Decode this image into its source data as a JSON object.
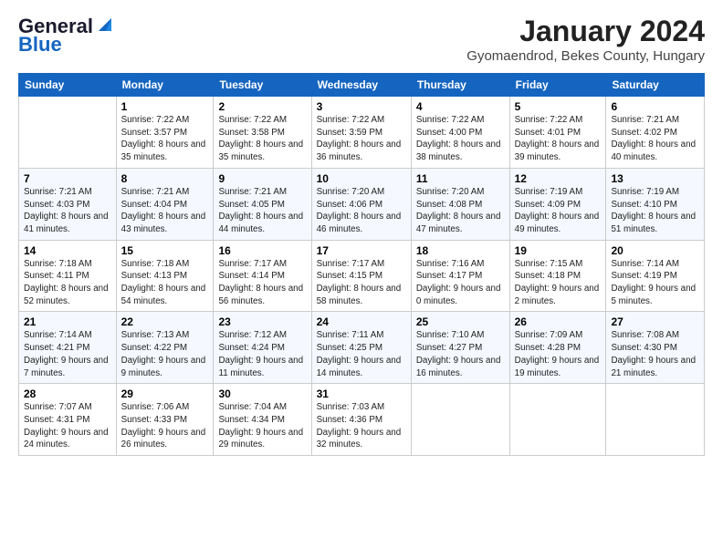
{
  "logo": {
    "line1": "General",
    "line2": "Blue"
  },
  "title": "January 2024",
  "subtitle": "Gyomaendrod, Bekes County, Hungary",
  "days_of_week": [
    "Sunday",
    "Monday",
    "Tuesday",
    "Wednesday",
    "Thursday",
    "Friday",
    "Saturday"
  ],
  "weeks": [
    [
      {
        "day": null,
        "info": null
      },
      {
        "day": "1",
        "sunrise": "7:22 AM",
        "sunset": "3:57 PM",
        "daylight": "8 hours and 35 minutes."
      },
      {
        "day": "2",
        "sunrise": "7:22 AM",
        "sunset": "3:58 PM",
        "daylight": "8 hours and 35 minutes."
      },
      {
        "day": "3",
        "sunrise": "7:22 AM",
        "sunset": "3:59 PM",
        "daylight": "8 hours and 36 minutes."
      },
      {
        "day": "4",
        "sunrise": "7:22 AM",
        "sunset": "4:00 PM",
        "daylight": "8 hours and 38 minutes."
      },
      {
        "day": "5",
        "sunrise": "7:22 AM",
        "sunset": "4:01 PM",
        "daylight": "8 hours and 39 minutes."
      },
      {
        "day": "6",
        "sunrise": "7:21 AM",
        "sunset": "4:02 PM",
        "daylight": "8 hours and 40 minutes."
      }
    ],
    [
      {
        "day": "7",
        "sunrise": "7:21 AM",
        "sunset": "4:03 PM",
        "daylight": "8 hours and 41 minutes."
      },
      {
        "day": "8",
        "sunrise": "7:21 AM",
        "sunset": "4:04 PM",
        "daylight": "8 hours and 43 minutes."
      },
      {
        "day": "9",
        "sunrise": "7:21 AM",
        "sunset": "4:05 PM",
        "daylight": "8 hours and 44 minutes."
      },
      {
        "day": "10",
        "sunrise": "7:20 AM",
        "sunset": "4:06 PM",
        "daylight": "8 hours and 46 minutes."
      },
      {
        "day": "11",
        "sunrise": "7:20 AM",
        "sunset": "4:08 PM",
        "daylight": "8 hours and 47 minutes."
      },
      {
        "day": "12",
        "sunrise": "7:19 AM",
        "sunset": "4:09 PM",
        "daylight": "8 hours and 49 minutes."
      },
      {
        "day": "13",
        "sunrise": "7:19 AM",
        "sunset": "4:10 PM",
        "daylight": "8 hours and 51 minutes."
      }
    ],
    [
      {
        "day": "14",
        "sunrise": "7:18 AM",
        "sunset": "4:11 PM",
        "daylight": "8 hours and 52 minutes."
      },
      {
        "day": "15",
        "sunrise": "7:18 AM",
        "sunset": "4:13 PM",
        "daylight": "8 hours and 54 minutes."
      },
      {
        "day": "16",
        "sunrise": "7:17 AM",
        "sunset": "4:14 PM",
        "daylight": "8 hours and 56 minutes."
      },
      {
        "day": "17",
        "sunrise": "7:17 AM",
        "sunset": "4:15 PM",
        "daylight": "8 hours and 58 minutes."
      },
      {
        "day": "18",
        "sunrise": "7:16 AM",
        "sunset": "4:17 PM",
        "daylight": "9 hours and 0 minutes."
      },
      {
        "day": "19",
        "sunrise": "7:15 AM",
        "sunset": "4:18 PM",
        "daylight": "9 hours and 2 minutes."
      },
      {
        "day": "20",
        "sunrise": "7:14 AM",
        "sunset": "4:19 PM",
        "daylight": "9 hours and 5 minutes."
      }
    ],
    [
      {
        "day": "21",
        "sunrise": "7:14 AM",
        "sunset": "4:21 PM",
        "daylight": "9 hours and 7 minutes."
      },
      {
        "day": "22",
        "sunrise": "7:13 AM",
        "sunset": "4:22 PM",
        "daylight": "9 hours and 9 minutes."
      },
      {
        "day": "23",
        "sunrise": "7:12 AM",
        "sunset": "4:24 PM",
        "daylight": "9 hours and 11 minutes."
      },
      {
        "day": "24",
        "sunrise": "7:11 AM",
        "sunset": "4:25 PM",
        "daylight": "9 hours and 14 minutes."
      },
      {
        "day": "25",
        "sunrise": "7:10 AM",
        "sunset": "4:27 PM",
        "daylight": "9 hours and 16 minutes."
      },
      {
        "day": "26",
        "sunrise": "7:09 AM",
        "sunset": "4:28 PM",
        "daylight": "9 hours and 19 minutes."
      },
      {
        "day": "27",
        "sunrise": "7:08 AM",
        "sunset": "4:30 PM",
        "daylight": "9 hours and 21 minutes."
      }
    ],
    [
      {
        "day": "28",
        "sunrise": "7:07 AM",
        "sunset": "4:31 PM",
        "daylight": "9 hours and 24 minutes."
      },
      {
        "day": "29",
        "sunrise": "7:06 AM",
        "sunset": "4:33 PM",
        "daylight": "9 hours and 26 minutes."
      },
      {
        "day": "30",
        "sunrise": "7:04 AM",
        "sunset": "4:34 PM",
        "daylight": "9 hours and 29 minutes."
      },
      {
        "day": "31",
        "sunrise": "7:03 AM",
        "sunset": "4:36 PM",
        "daylight": "9 hours and 32 minutes."
      },
      {
        "day": null,
        "info": null
      },
      {
        "day": null,
        "info": null
      },
      {
        "day": null,
        "info": null
      }
    ]
  ]
}
